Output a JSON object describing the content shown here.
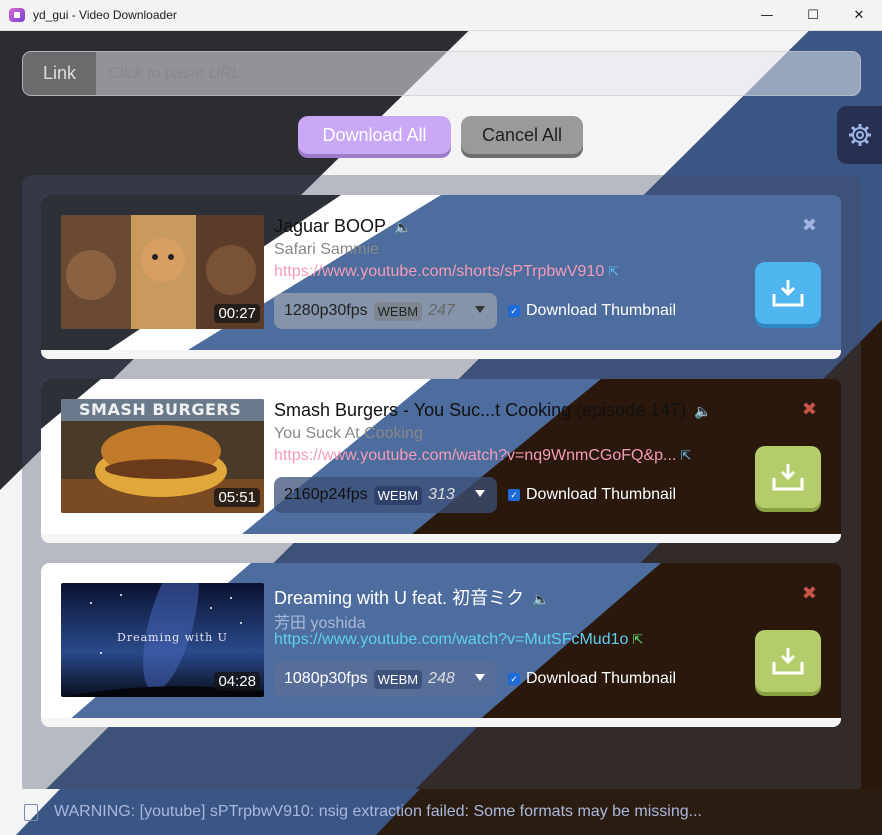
{
  "window": {
    "title": "yd_gui - Video Downloader",
    "minimize": "—",
    "maximize": "☐",
    "close": "✕"
  },
  "url_bar": {
    "label": "Link",
    "placeholder": "Click to paste URL"
  },
  "actions": {
    "download_all": "Download All",
    "cancel_all": "Cancel All"
  },
  "icons": {
    "settings": "gear-icon",
    "speaker": "speaker-icon",
    "external_link": "external-link-icon",
    "download": "download-icon",
    "close": "close-icon",
    "log": "log-icon"
  },
  "videos": [
    {
      "title": "Jaguar BOOP",
      "channel": "Safari Sammie",
      "url": "https://www.youtube.com/shorts/sPTrpbwV910",
      "duration": "00:27",
      "format": "1280p30fps",
      "container": "WEBM",
      "format_id": "247",
      "thumbnail_option": "Download Thumbnail",
      "close": "✖",
      "speaker": "🔈",
      "ext": "⇱",
      "check": "✓"
    },
    {
      "title": "Smash Burgers - You Suc...t Cooking (episode 147)",
      "channel": "You Suck At Cooking",
      "url": "https://www.youtube.com/watch?v=nq9WnmCGoFQ&p...",
      "duration": "05:51",
      "format": "2160p24fps",
      "container": "WEBM",
      "format_id": "313",
      "thumbnail_option": "Download Thumbnail",
      "thumb_caption": "SMASH BURGERS",
      "close": "✖",
      "speaker": "🔈",
      "ext": "⇱",
      "check": "✓"
    },
    {
      "title": "Dreaming with U feat. 初音ミク",
      "channel": "芳田 yoshida",
      "url": "https://www.youtube.com/watch?v=MutSFcMud1o",
      "duration": "04:28",
      "format": "1080p30fps",
      "container": "WEBM",
      "format_id": "248",
      "thumbnail_option": "Download Thumbnail",
      "thumb_caption": "Dreaming with U",
      "close": "✖",
      "speaker": "🔈",
      "ext": "⇱",
      "check": "✓"
    }
  ],
  "status": {
    "text": "WARNING: [youtube] sPTrpbwV910: nsig extraction failed: Some formats may be missing..."
  },
  "colors": {
    "light_bg": "#f3f3f3",
    "dark_bg": "#2b2d33",
    "blue_bg": "#3d5a8a",
    "brown_bg": "#2a1a0f",
    "accent_purple": "#c9a8f5",
    "blue_button": "#4fb5ee",
    "green_button": "#b5cc6a"
  }
}
